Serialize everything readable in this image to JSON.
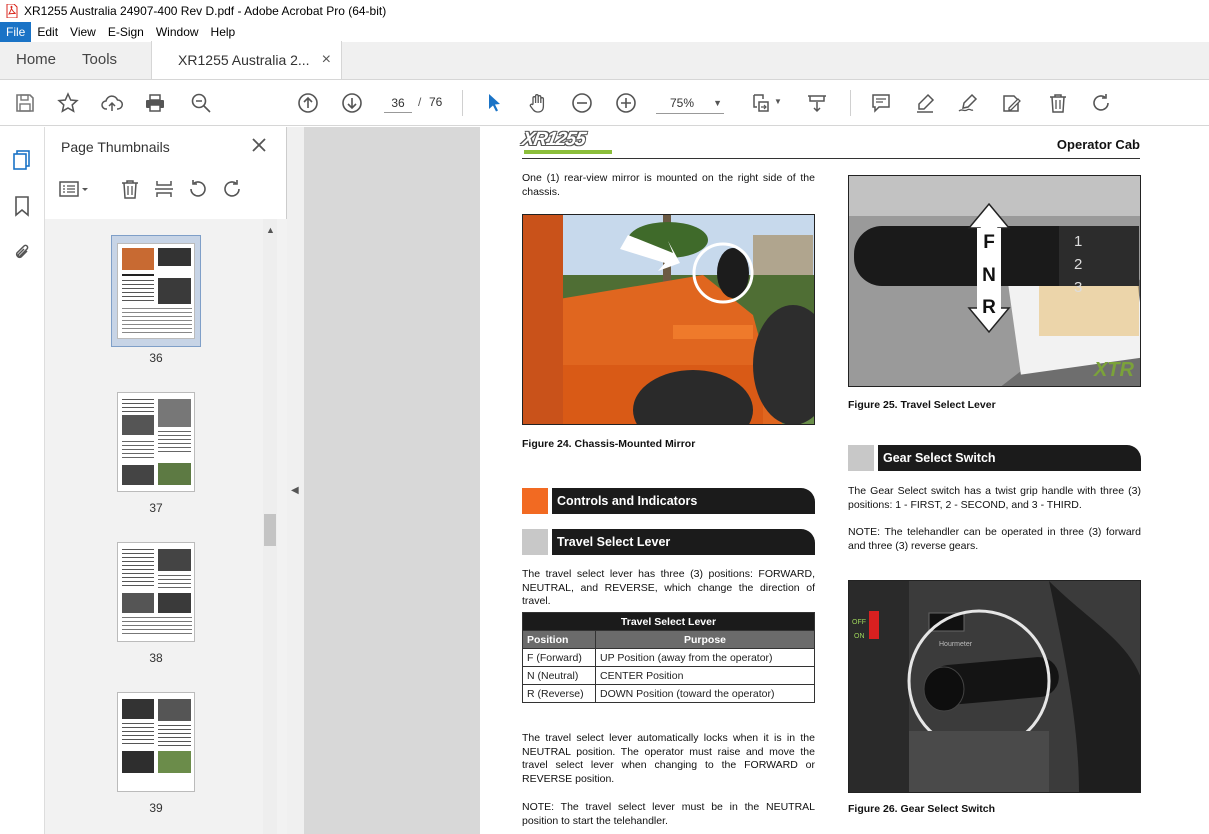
{
  "window": {
    "title": "XR1255 Australia 24907-400 Rev D.pdf - Adobe Acrobat Pro (64-bit)"
  },
  "menu": [
    "File",
    "Edit",
    "View",
    "E-Sign",
    "Window",
    "Help"
  ],
  "tabs": {
    "home": "Home",
    "tools": "Tools",
    "doc": "XR1255 Australia 2...",
    "close_glyph": "×"
  },
  "toolbar": {
    "page_current": "36",
    "page_sep": "/",
    "page_total": "76",
    "zoom": "75%"
  },
  "panel": {
    "title": "Page Thumbnails",
    "thumbnails": [
      "36",
      "37",
      "38",
      "39"
    ]
  },
  "page": {
    "logo": "XR1255",
    "header": "Operator Cab",
    "mirror_text": "One (1) rear-view mirror is mounted on the right side of the chassis.",
    "fig24_caption": "Figure 24.  Chassis-Mounted Mirror",
    "fig25_caption": "Figure 25.  Travel Select Lever",
    "fig26_caption": "Figure 26.  Gear Select Switch",
    "fig25_labels": {
      "f": "F",
      "n": "N",
      "r": "R",
      "g1": "1",
      "g2": "2",
      "g3": "3",
      "brand": "XTR"
    },
    "sec_controls": "Controls and Indicators",
    "sec_travel": "Travel Select Lever",
    "sec_gear": "Gear Select Switch",
    "travel_text": "The travel select lever has three (3) positions: FORWARD, NEUTRAL, and REVERSE, which change the direction of travel.",
    "table": {
      "title": "Travel Select Lever",
      "headers": [
        "Position",
        "Purpose"
      ],
      "rows": [
        [
          "F   (Forward)",
          "UP Position (away from the operator)"
        ],
        [
          "N   (Neutral)",
          "CENTER Position"
        ],
        [
          "R   (Reverse)",
          "DOWN Position (toward the operator)"
        ]
      ]
    },
    "lock_text": "The travel select lever automatically locks when it is in the NEUTRAL position. The operator must raise and move the travel select lever when changing to the FORWARD or REVERSE position.",
    "note_neutral": "NOTE: The travel select lever must be in the NEUTRAL position to start the telehandler.",
    "gear_text": "The Gear Select switch has a twist grip handle with three (3) positions: 1 - FIRST, 2 - SECOND, and 3 - THIRD.",
    "note_gears": "NOTE:  The telehandler can be operated in three (3) forward and three (3) reverse gears.",
    "fig26_labels": {
      "off": "OFF",
      "on": "ON",
      "hourmeter": "Hourmeter"
    }
  },
  "colors": {
    "accent_orange": "#f26a22",
    "section_gray": "#c8c8c8",
    "menu_active": "#1a73c6"
  }
}
